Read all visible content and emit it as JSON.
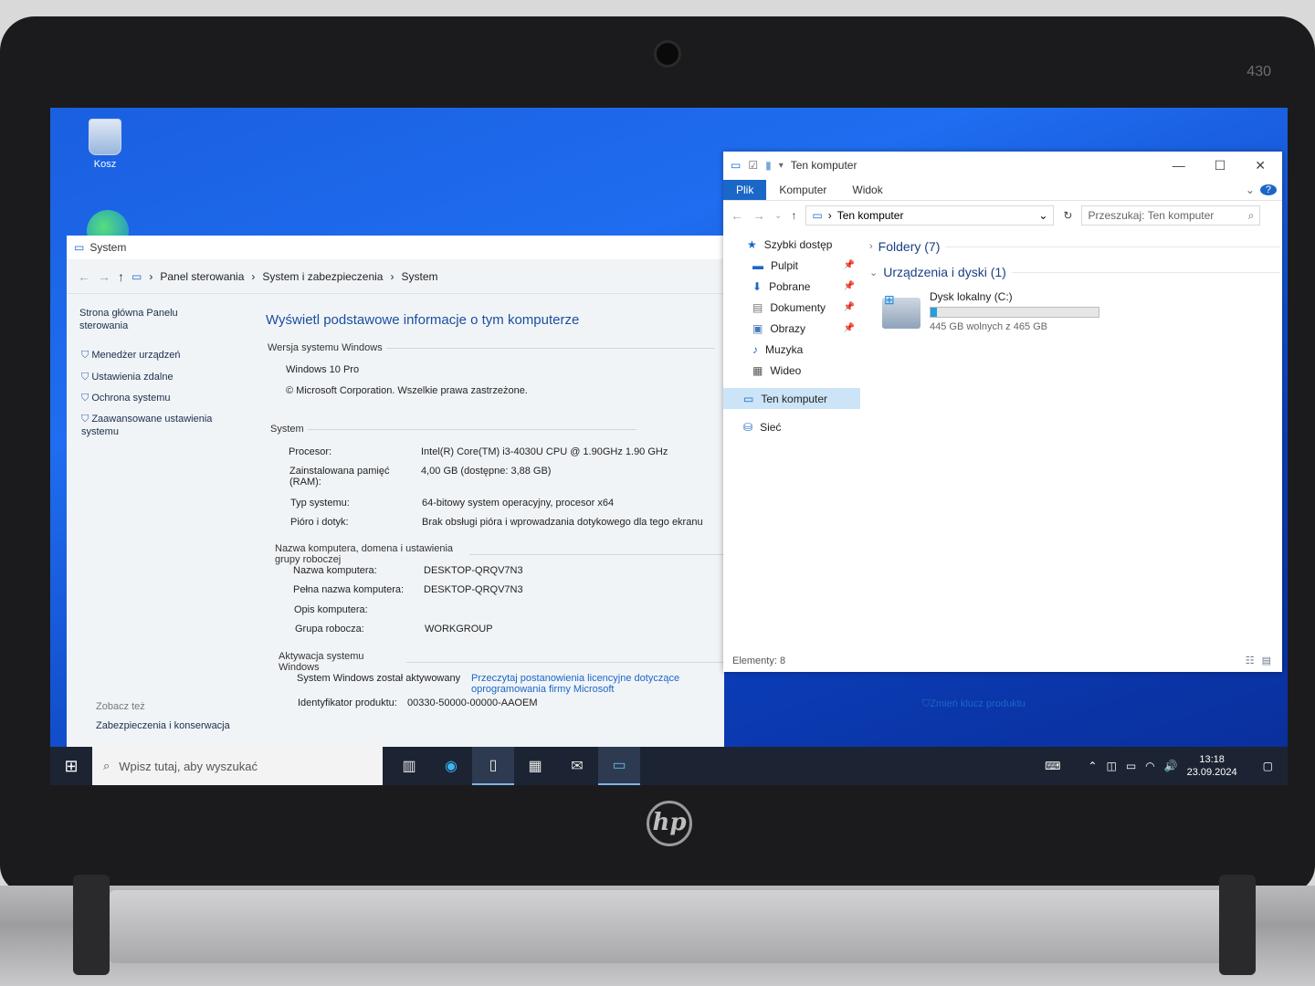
{
  "device": {
    "model_number": "430",
    "brand_logo": "hp"
  },
  "desktop": {
    "recycle_bin_label": "Kosz"
  },
  "system_window": {
    "title": "System",
    "breadcrumb": [
      "Panel sterowania",
      "System i zabezpieczenia",
      "System"
    ],
    "left_nav": {
      "home": "Strona główna Panelu sterowania",
      "links": [
        "Menedżer urządzeń",
        "Ustawienia zdalne",
        "Ochrona systemu",
        "Zaawansowane ustawienia systemu"
      ],
      "see_also_label": "Zobacz też",
      "see_also_link": "Zabezpieczenia i konserwacja"
    },
    "heading": "Wyświetl podstawowe informacje o tym komputerze",
    "edition_section": "Wersja systemu Windows",
    "edition": "Windows 10 Pro",
    "copyright": "© Microsoft Corporation. Wszelkie prawa zastrzeżone.",
    "system_section": "System",
    "processor_label": "Procesor:",
    "processor_value": "Intel(R) Core(TM) i3-4030U CPU @ 1.90GHz   1.90 GHz",
    "ram_label": "Zainstalowana pamięć (RAM):",
    "ram_value": "4,00 GB (dostępne: 3,88 GB)",
    "type_label": "Typ systemu:",
    "type_value": "64-bitowy system operacyjny, procesor x64",
    "pen_label": "Pióro i dotyk:",
    "pen_value": "Brak obsługi pióra i wprowadzania dotykowego dla tego ekranu",
    "name_section": "Nazwa komputera, domena i ustawienia grupy roboczej",
    "comp_name_label": "Nazwa komputera:",
    "comp_name_value": "DESKTOP-QRQV7N3",
    "full_name_label": "Pełna nazwa komputera:",
    "full_name_value": "DESKTOP-QRQV7N3",
    "desc_label": "Opis komputera:",
    "workgroup_label": "Grupa robocza:",
    "workgroup_value": "WORKGROUP",
    "activation_section": "Aktywacja systemu Windows",
    "activation_status": "System Windows został aktywowany",
    "license_link": "Przeczytaj postanowienia licencyjne dotyczące oprogramowania firmy Microsoft",
    "product_id_label": "Identyfikator produktu:",
    "product_id_value": "00330-50000-00000-AAOEM",
    "change_key_link": "Zmień klucz produktu"
  },
  "explorer_window": {
    "title": "Ten komputer",
    "ribbon_tabs": [
      "Plik",
      "Komputer",
      "Widok"
    ],
    "address": "Ten komputer",
    "search_placeholder": "Przeszukaj: Ten komputer",
    "nav": {
      "quick_access": "Szybki dostęp",
      "pinned": [
        "Pulpit",
        "Pobrane",
        "Dokumenty",
        "Obrazy"
      ],
      "items": [
        "Muzyka",
        "Wideo"
      ],
      "this_pc": "Ten komputer",
      "network": "Sieć"
    },
    "folders_group": "Foldery (7)",
    "devices_group": "Urządzenia i dyski (1)",
    "drive_name": "Dysk lokalny (C:)",
    "drive_free": "445 GB wolnych z 465 GB",
    "drive_used_fraction": 0.04,
    "status": "Elementy: 8"
  },
  "taskbar": {
    "search_placeholder": "Wpisz tutaj, aby wyszukać",
    "time": "13:18",
    "date": "23.09.2024"
  }
}
